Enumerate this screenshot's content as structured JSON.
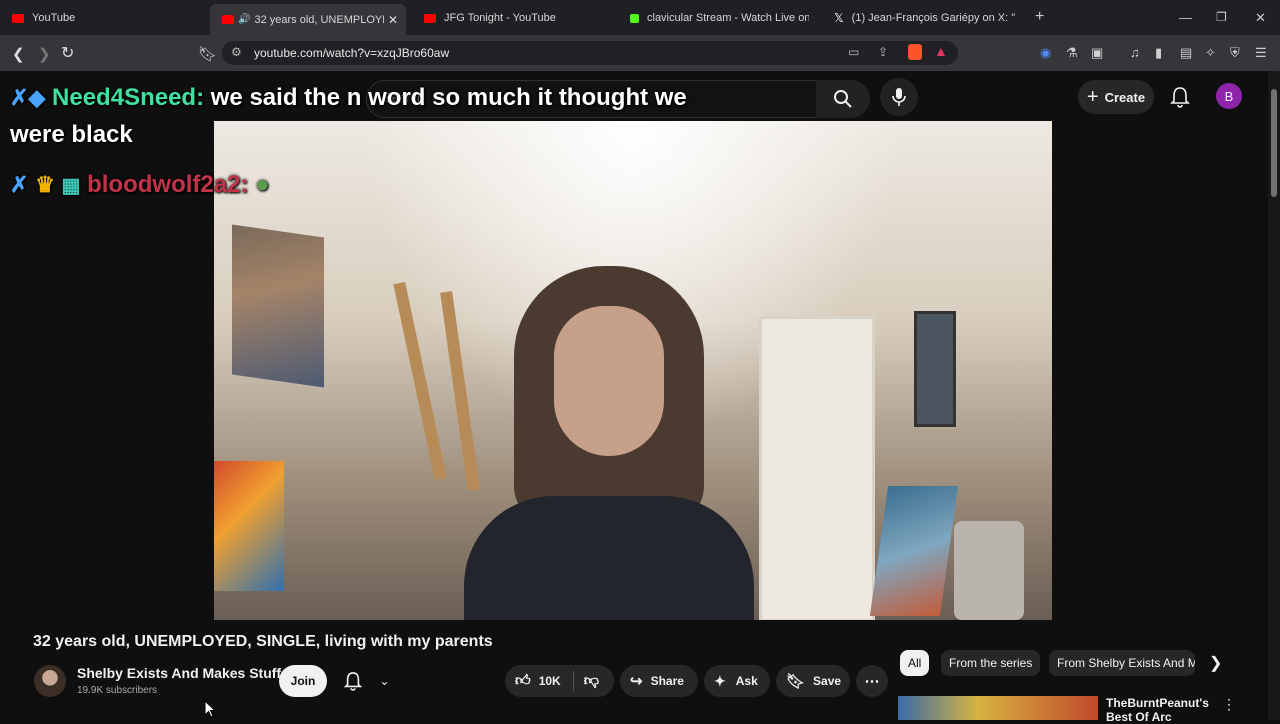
{
  "tabs": [
    {
      "label": "YouTube",
      "fav_color": "#ff0000"
    },
    {
      "label": "32 years old, UNEMPLOYED, S",
      "fav_color": "#ff0000"
    },
    {
      "label": "JFG Tonight - YouTube",
      "fav_color": "#ff0000"
    },
    {
      "label": "clavicular Stream - Watch Live on Kic",
      "fav_color": "#53fc18"
    },
    {
      "label": "(1) Jean-François Gariépy on X: \"",
      "fav_color": "#ffffff"
    }
  ],
  "address": {
    "url": "youtube.com/watch?v=xzqJBro60aw"
  },
  "youtube": {
    "search_placeholder": "Search",
    "create_label": "Create",
    "avatar_letter": "B"
  },
  "chat": {
    "line1_user": "Need4Sneed:",
    "line1_msg": "we said the n word so much it thought we",
    "line2": "were black",
    "line3_user": "bloodwolf2a2:"
  },
  "video": {
    "title": "32 years old, UNEMPLOYED, SINGLE, living with my parents",
    "channel_name": "Shelby Exists And Makes Stuff",
    "subscribers": "19.9K subscribers",
    "join_label": "Join",
    "likes": "10K",
    "share_label": "Share",
    "ask_label": "Ask",
    "save_label": "Save"
  },
  "chips": [
    "All",
    "From the series",
    "From Shelby Exists And M"
  ],
  "recommendation": {
    "title_line1": "TheBurntPeanut's",
    "title_line2": "Best Of Arc"
  }
}
